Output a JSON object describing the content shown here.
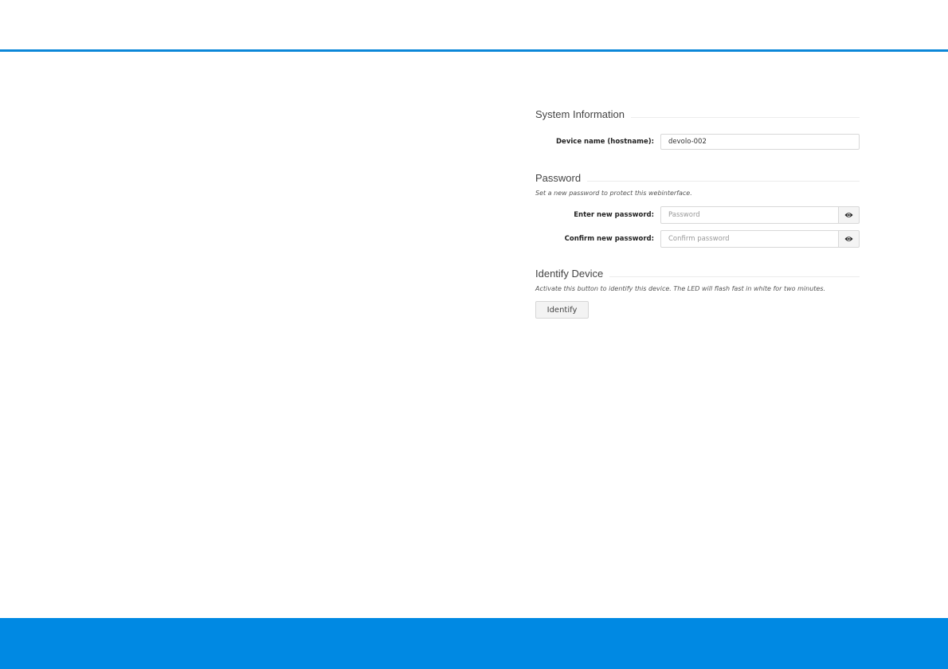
{
  "system_information": {
    "title": "System Information",
    "hostname_label": "Device name (hostname):",
    "hostname_value": "devolo-002"
  },
  "password": {
    "title": "Password",
    "description": "Set a new password to protect this webinterface.",
    "new_label": "Enter new password:",
    "new_placeholder": "Password",
    "confirm_label": "Confirm new password:",
    "confirm_placeholder": "Confirm password",
    "toggle_icon": "eye-icon"
  },
  "identify": {
    "title": "Identify Device",
    "description": "Activate this button to identify this device. The LED will flash fast in white for two minutes.",
    "button_label": "Identify"
  },
  "colors": {
    "accent": "#0089e3",
    "rule": "#0b87d8"
  }
}
